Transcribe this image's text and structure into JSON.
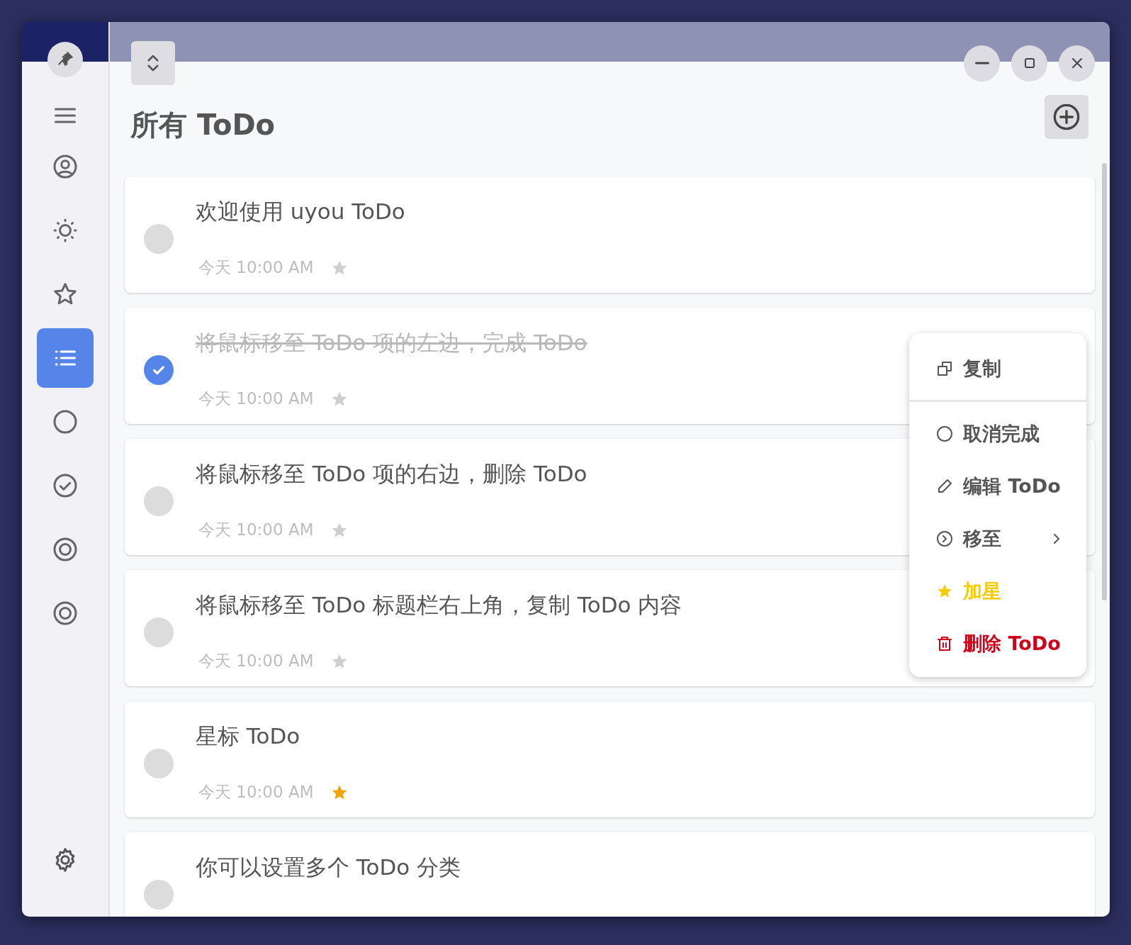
{
  "sidebar": {
    "items": [
      {
        "selected": false
      },
      {
        "selected": false
      },
      {
        "selected": false
      },
      {
        "selected": false
      },
      {
        "selected": true
      },
      {
        "selected": false
      },
      {
        "selected": false
      },
      {
        "selected": false
      },
      {
        "selected": false
      }
    ]
  },
  "header": {
    "title": "所有 ToDo"
  },
  "todos": [
    {
      "title": "欢迎使用 uyou ToDo",
      "time": "今天 10:00 AM",
      "done": false,
      "starred": false
    },
    {
      "title": "将鼠标移至 ToDo 项的左边，完成 ToDo",
      "time": "今天 10:00 AM",
      "done": true,
      "starred": false
    },
    {
      "title": "将鼠标移至 ToDo 项的右边，删除 ToDo",
      "time": "今天 10:00 AM",
      "done": false,
      "starred": false
    },
    {
      "title": "将鼠标移至 ToDo 标题栏右上角，复制 ToDo 内容",
      "time": "今天 10:00 AM",
      "done": false,
      "starred": false
    },
    {
      "title": "星标 ToDo",
      "time": "今天 10:00 AM",
      "done": false,
      "starred": true
    },
    {
      "title": "你可以设置多个 ToDo 分类",
      "done": false
    }
  ],
  "context_menu": {
    "items": [
      {
        "kind": "copy",
        "label": "复制"
      },
      {
        "kind": "uncomplete",
        "label": "取消完成"
      },
      {
        "kind": "edit",
        "label": "编辑 ToDo"
      },
      {
        "kind": "move",
        "label": "移至"
      },
      {
        "kind": "star",
        "label": "加星"
      },
      {
        "kind": "delete",
        "label": "删除 ToDo"
      }
    ]
  }
}
